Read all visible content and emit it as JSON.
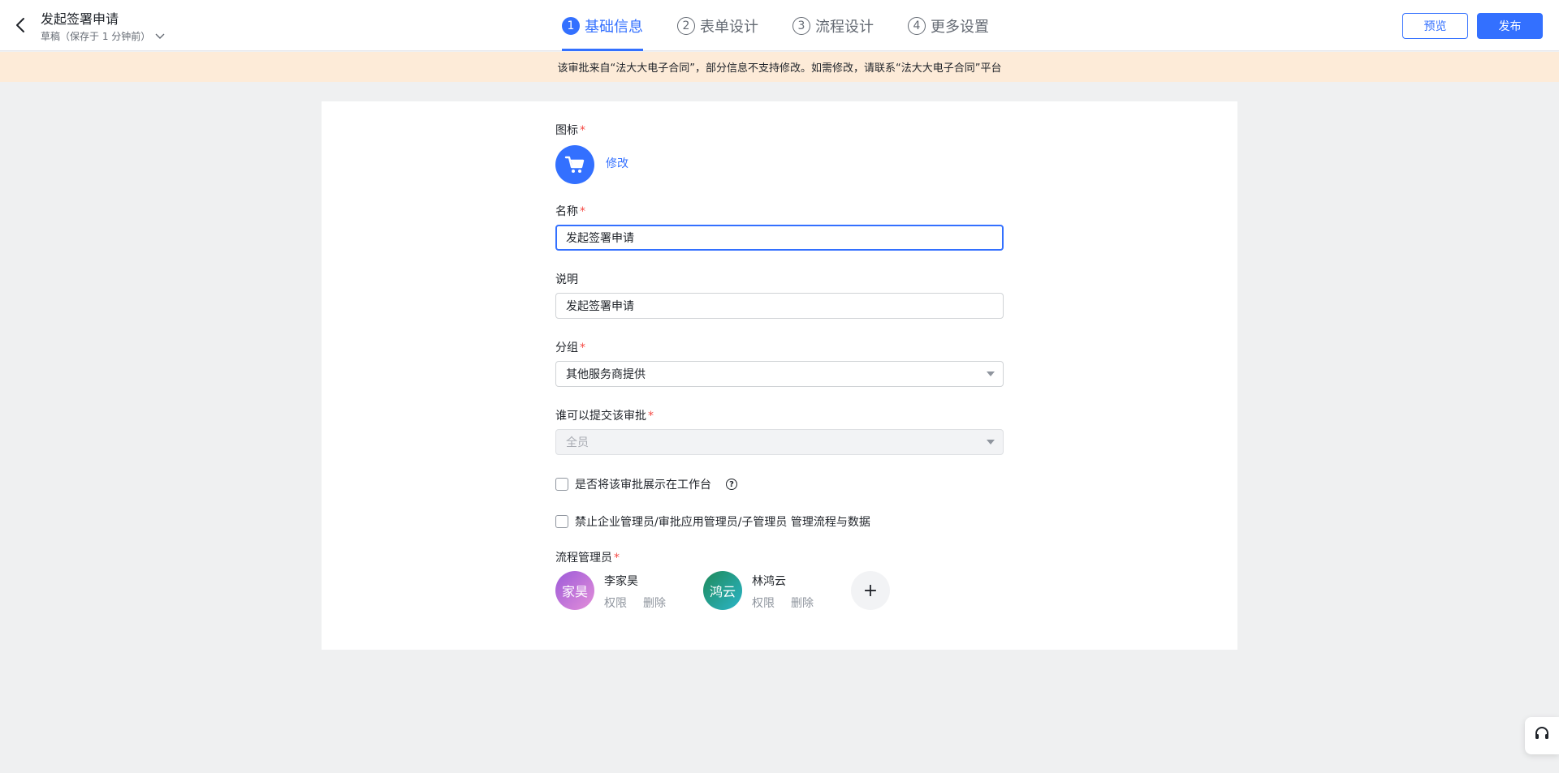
{
  "header": {
    "title": "发起签署申请",
    "subtitle": "草稿（保存于 1 分钟前）",
    "steps": [
      {
        "num": "1",
        "label": "基础信息"
      },
      {
        "num": "2",
        "label": "表单设计"
      },
      {
        "num": "3",
        "label": "流程设计"
      },
      {
        "num": "4",
        "label": "更多设置"
      }
    ],
    "active_step": 1,
    "preview_label": "预览",
    "publish_label": "发布"
  },
  "notice": "该审批来自“法大大电子合同”，部分信息不支持修改。如需修改，请联系“法大大电子合同”平台",
  "form": {
    "icon_label": "图标",
    "icon_name": "shopping-cart-icon",
    "icon_modify": "修改",
    "name_label": "名称",
    "name_value": "发起签署申请",
    "desc_label": "说明",
    "desc_value": "发起签署申请",
    "group_label": "分组",
    "group_value": "其他服务商提供",
    "submitter_label": "谁可以提交该审批",
    "submitter_value": "全员",
    "show_workbench_label": "是否将该审批展示在工作台",
    "forbid_admin_label": "禁止企业管理员/审批应用管理员/子管理员 管理流程与数据",
    "admins_label": "流程管理员",
    "admins": [
      {
        "avatar_text": "家昊",
        "name": "李家昊",
        "perm": "权限",
        "delete": "删除"
      },
      {
        "avatar_text": "鸿云",
        "name": "林鸿云",
        "perm": "权限",
        "delete": "删除"
      }
    ],
    "add_admin": "+"
  },
  "colors": {
    "accent": "#3370ff",
    "notice_bg": "#fdebd8",
    "required": "#f54a45"
  }
}
